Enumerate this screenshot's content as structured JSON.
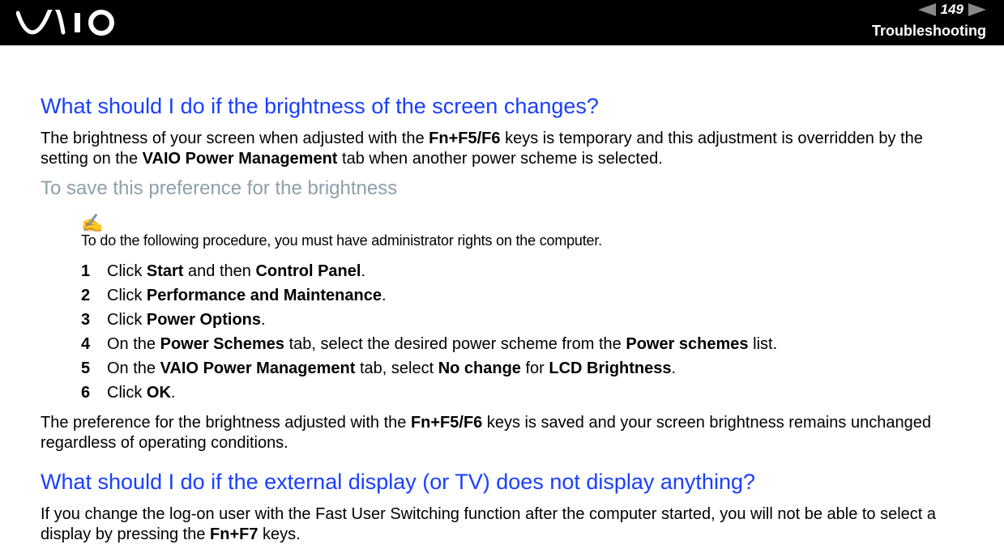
{
  "header": {
    "page_number": "149",
    "section": "Troubleshooting"
  },
  "q1": {
    "heading": "What should I do if the brightness of the screen changes?",
    "para_pre": "The brightness of your screen when adjusted with the ",
    "para_b1": "Fn+F5/F6",
    "para_mid": " keys is temporary and this adjustment is overridden by the setting on the ",
    "para_b2": "VAIO Power Management",
    "para_post": " tab when another power scheme is selected.",
    "subheading": "To save this preference for the brightness",
    "note_icon": "✍",
    "note": "To do the following procedure, you must have administrator rights on the computer.",
    "steps": {
      "n1": "1",
      "s1a": "Click ",
      "s1b": "Start",
      "s1c": " and then ",
      "s1d": "Control Panel",
      "s1e": ".",
      "n2": "2",
      "s2a": "Click ",
      "s2b": "Performance and Maintenance",
      "s2c": ".",
      "n3": "3",
      "s3a": "Click ",
      "s3b": "Power Options",
      "s3c": ".",
      "n4": "4",
      "s4a": "On the ",
      "s4b": "Power Schemes",
      "s4c": " tab, select the desired power scheme from the ",
      "s4d": "Power schemes",
      "s4e": " list.",
      "n5": "5",
      "s5a": "On the ",
      "s5b": "VAIO Power Management",
      "s5c": " tab, select ",
      "s5d": "No change",
      "s5e": " for ",
      "s5f": "LCD Brightness",
      "s5g": ".",
      "n6": "6",
      "s6a": "Click ",
      "s6b": "OK",
      "s6c": "."
    },
    "after_pre": "The preference for the brightness adjusted with the ",
    "after_b": "Fn+F5/F6",
    "after_post": " keys is saved and your screen brightness remains unchanged regardless of operating conditions."
  },
  "q2": {
    "heading": "What should I do if the external display (or TV) does not display anything?",
    "para_pre": "If you change the log-on user with the Fast User Switching function after the computer started, you will not be able to select a display by pressing the ",
    "para_b": "Fn+F7",
    "para_post": " keys."
  }
}
